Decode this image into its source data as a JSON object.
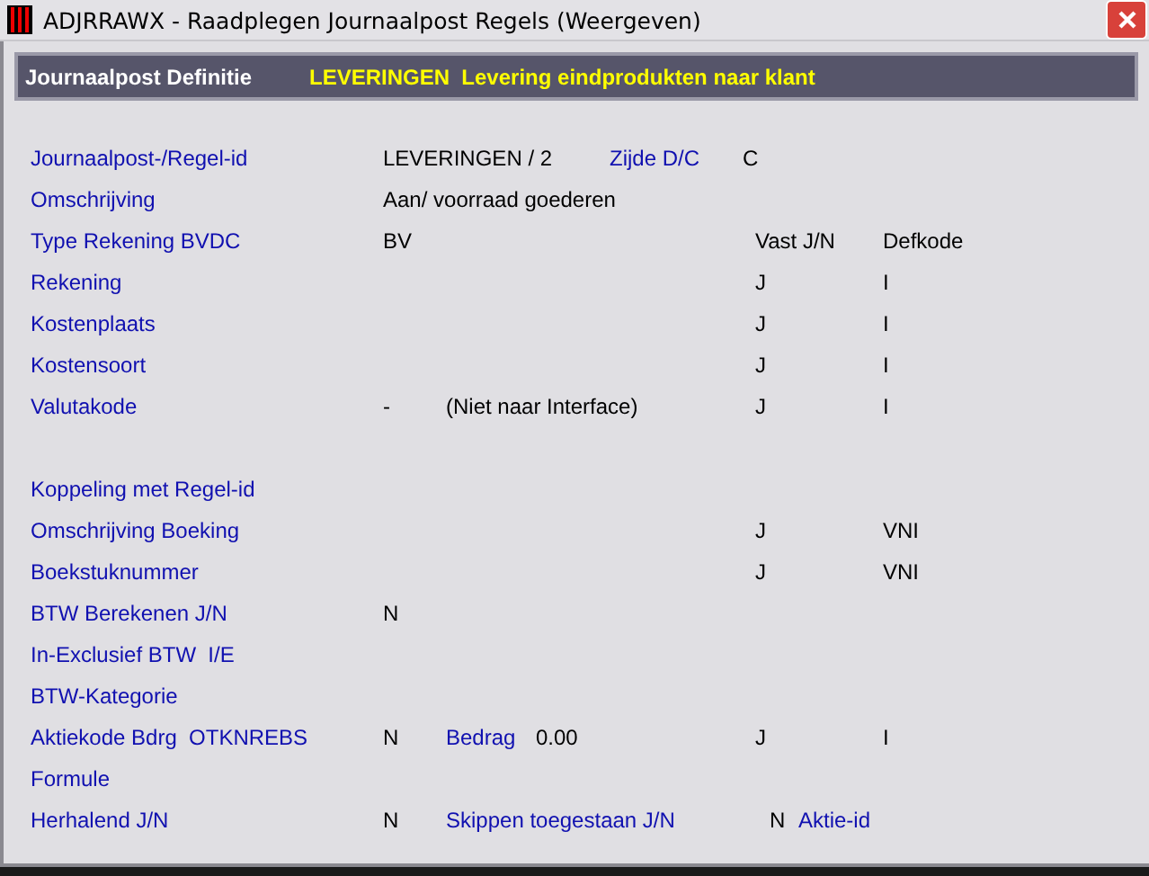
{
  "window": {
    "title": "ADJRRAWX - Raadplegen Journaalpost Regels (Weergeven)"
  },
  "header": {
    "label": "Journaalpost Definitie",
    "value": "LEVERINGEN  Levering eindprodukten naar klant"
  },
  "sections": [
    {
      "rows": [
        {
          "label": "Journaalpost-/Regel-id",
          "value": "LEVERINGEN / 2",
          "side_label": "Zijde D/C",
          "side_value": "C"
        },
        {
          "label": "Omschrijving",
          "value": "Aan/ voorraad goederen"
        },
        {
          "label": "Type Rekening BVDC",
          "value": "BV",
          "vast": "Vast J/N",
          "defkode": "Defkode"
        },
        {
          "label": "Rekening",
          "vast": "J",
          "defkode": "I"
        },
        {
          "label": "Kostenplaats",
          "vast": "J",
          "defkode": "I"
        },
        {
          "label": "Kostensoort",
          "vast": "J",
          "defkode": "I"
        },
        {
          "label": "Valutakode",
          "value": "-",
          "note": "(Niet naar Interface)",
          "vast": "J",
          "defkode": "I"
        }
      ]
    },
    {
      "rows": [
        {
          "label": "Koppeling met Regel-id"
        },
        {
          "label": "Omschrijving Boeking",
          "vast": "J",
          "defkode": "VNI"
        },
        {
          "label": "Boekstuknummer",
          "vast": "J",
          "defkode": "VNI"
        },
        {
          "label": "BTW Berekenen J/N",
          "value": "N"
        },
        {
          "label": "In-Exclusief BTW  I/E"
        },
        {
          "label": "BTW-Kategorie"
        },
        {
          "label": "Aktiekode Bdrg  OTKNREBS",
          "value": "N",
          "sub_label": "Bedrag",
          "sub_value": "0.00",
          "vast": "J",
          "defkode": "I"
        },
        {
          "label": "Formule"
        },
        {
          "label": "Herhalend J/N",
          "value": "N",
          "sub_label": "Skippen toegestaan J/N",
          "flag": "N",
          "flag_label": "Aktie-id"
        }
      ]
    }
  ]
}
